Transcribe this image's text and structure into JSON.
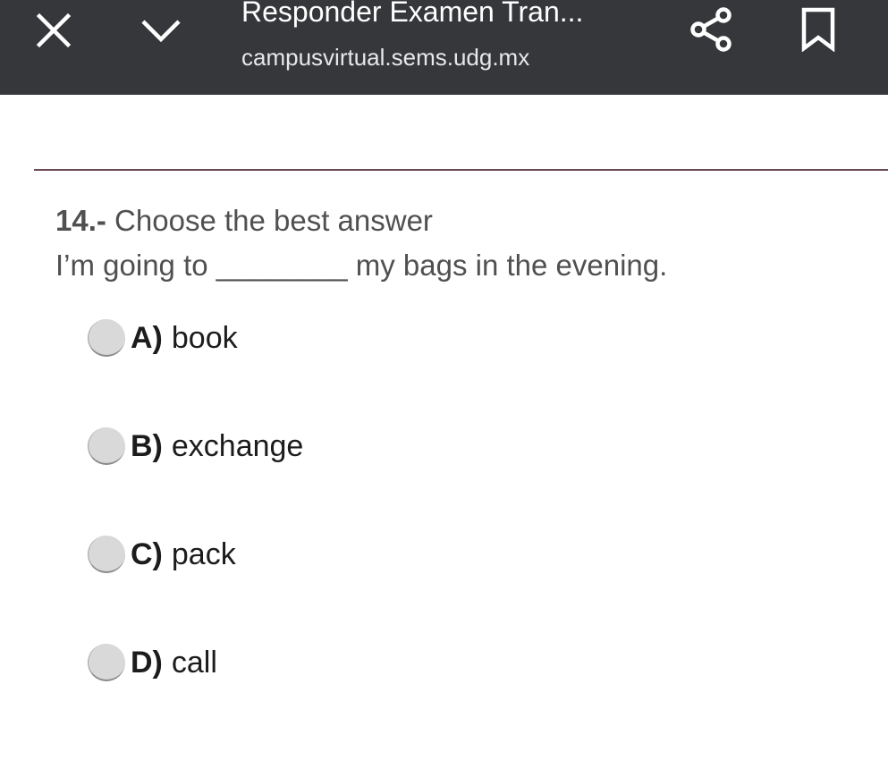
{
  "topbar": {
    "title": "Responder Examen Tran...",
    "url": "campusvirtual.sems.udg.mx",
    "icons": {
      "close": "close-icon",
      "expand": "chevron-down-icon",
      "share": "share-icon",
      "bookmark": "bookmark-icon"
    },
    "colors": {
      "background": "#36373b",
      "text": "#ffffff"
    }
  },
  "question": {
    "number": "14.-",
    "prompt": "Choose the best answer",
    "sentence": "I’m going to ________ my bags in the evening.",
    "options": [
      {
        "letter": "A)",
        "text": "book"
      },
      {
        "letter": "B)",
        "text": "exchange"
      },
      {
        "letter": "C)",
        "text": "pack"
      },
      {
        "letter": "D)",
        "text": "call"
      }
    ]
  }
}
